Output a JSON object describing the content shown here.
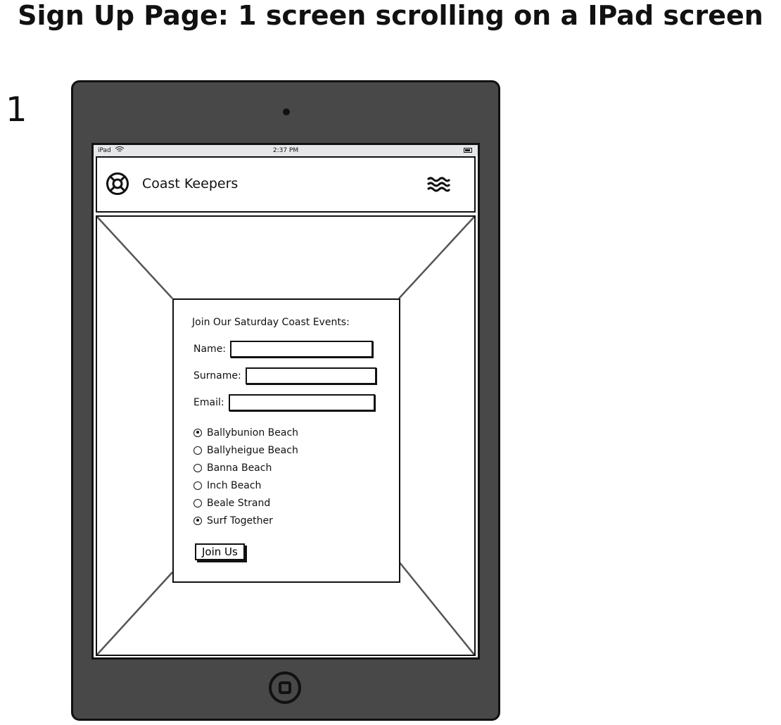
{
  "page": {
    "title": "Sign Up Page: 1 screen scrolling on a IPad screen",
    "frame_number": "1"
  },
  "device": {
    "status_bar": {
      "device_name": "iPad",
      "time": "2:37 PM"
    }
  },
  "navbar": {
    "brand": "Coast Keepers",
    "logo_icon": "lifebuoy-icon",
    "menu_icon": "waves-menu-icon"
  },
  "form": {
    "heading": "Join Our Saturday Coast Events:",
    "fields": {
      "name": {
        "label": "Name:",
        "value": ""
      },
      "surname": {
        "label": "Surname:",
        "value": ""
      },
      "email": {
        "label": "Email:",
        "value": ""
      }
    },
    "options": [
      {
        "label": "Ballybunion Beach",
        "checked": true
      },
      {
        "label": "Ballyheigue Beach",
        "checked": false
      },
      {
        "label": "Banna Beach",
        "checked": false
      },
      {
        "label": "Inch Beach",
        "checked": false
      },
      {
        "label": "Beale Strand",
        "checked": false
      },
      {
        "label": "Surf Together",
        "checked": true
      }
    ],
    "submit_label": "Join Us"
  }
}
